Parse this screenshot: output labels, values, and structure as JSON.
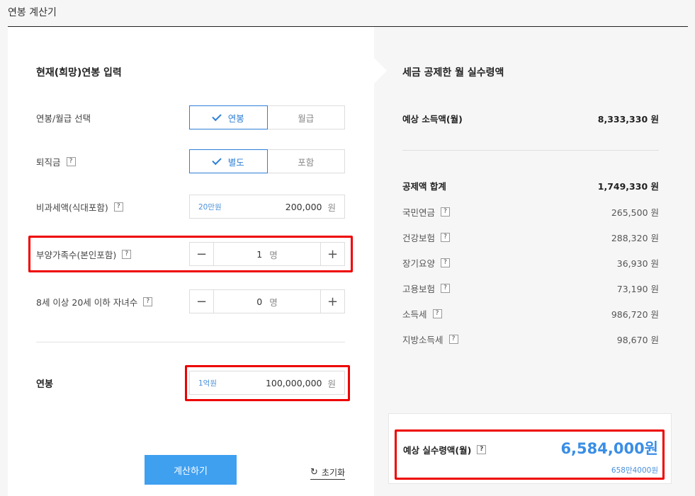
{
  "page": {
    "title": "연봉 계산기"
  },
  "input": {
    "section_title": "현재(희망)연봉 입력",
    "salary_type": {
      "label": "연봉/월급 선택",
      "options": [
        "연봉",
        "월급"
      ],
      "selected": "연봉"
    },
    "severance": {
      "label": "퇴직금",
      "options": [
        "별도",
        "포함"
      ],
      "selected": "별도"
    },
    "nontax": {
      "label": "비과세액(식대포함)",
      "hint": "20만원",
      "value": "200,000",
      "unit": "원"
    },
    "dependents": {
      "label": "부양가족수(본인포함)",
      "value": "1",
      "unit": "명"
    },
    "children": {
      "label": "8세 이상 20세 이하 자녀수",
      "value": "0",
      "unit": "명"
    },
    "annual": {
      "label": "연봉",
      "hint": "1억원",
      "value": "100,000,000",
      "unit": "원"
    },
    "calc_button": "계산하기",
    "reset_label": "초기화",
    "help_glyph": "?",
    "minus_glyph": "−",
    "plus_glyph": "+"
  },
  "result": {
    "section_title": "세금 공제한 월 실수령액",
    "income": {
      "label": "예상 소득액(월)",
      "value": "8,333,330 원"
    },
    "deduction_total": {
      "label": "공제액 합계",
      "value": "1,749,330 원"
    },
    "items": [
      {
        "label": "국민연금",
        "value": "265,500 원"
      },
      {
        "label": "건강보험",
        "value": "288,320 원"
      },
      {
        "label": "장기요양",
        "value": "36,930 원"
      },
      {
        "label": "고용보험",
        "value": "73,190 원"
      },
      {
        "label": "소득세",
        "value": "986,720 원"
      },
      {
        "label": "지방소득세",
        "value": "98,670 원"
      }
    ],
    "net": {
      "label": "예상 실수령액(월)",
      "value": "6,584,000원",
      "sub": "658만4000원"
    }
  },
  "colors": {
    "accent": "#2f7fd6",
    "button": "#3fa0f0",
    "highlight": "#e00000"
  }
}
